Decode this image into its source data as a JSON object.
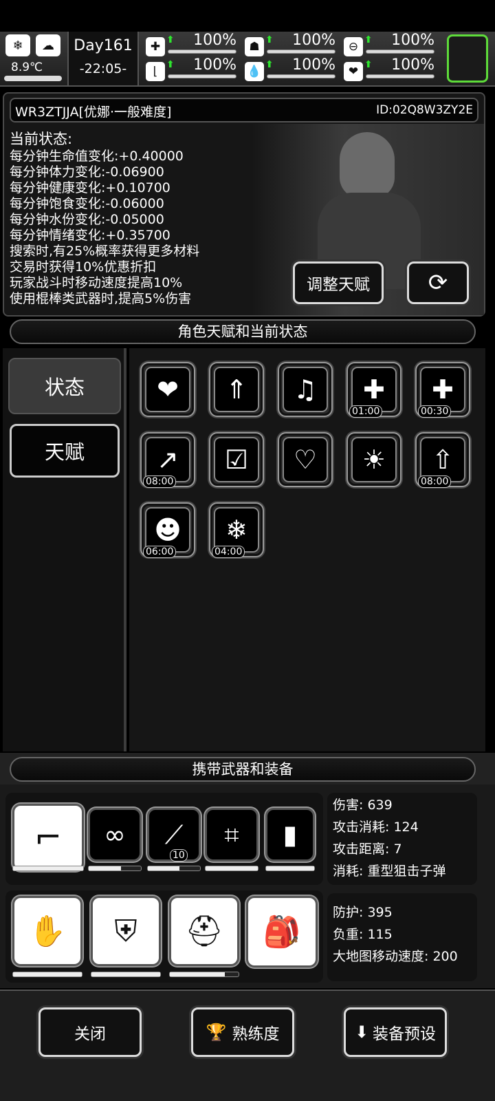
{
  "hud": {
    "season_icon": "snowflake-icon",
    "weather_icon": "cloud-icon",
    "temperature": "8.9℃",
    "day": "Day161",
    "time": "-22:05-",
    "stats": [
      {
        "icon": "medkit-icon",
        "value": "100%",
        "level": 1.0
      },
      {
        "icon": "stomach-icon",
        "value": "100%",
        "level": 1.0
      },
      {
        "icon": "lock-icon",
        "value": "100%",
        "level": 1.0
      },
      {
        "icon": "boot-icon",
        "value": "100%",
        "level": 1.0
      },
      {
        "icon": "water-drop-icon",
        "value": "100%",
        "level": 1.0
      },
      {
        "icon": "heart-icon",
        "value": "100%",
        "level": 1.0
      }
    ],
    "accent": "#2ee52e"
  },
  "character": {
    "name": "WR3ZTJJA[优娜·一般难度]",
    "id": "ID:02Q8W3ZY2E",
    "status_title": "当前状态:",
    "status_lines": [
      "每分钟生命值变化:+0.40000",
      "每分钟体力变化:-0.06900",
      "每分钟健康变化:+0.10700",
      "每分钟饱食变化:-0.06000",
      "每分钟水份变化:-0.05000",
      "每分钟情绪变化:+0.35700",
      "搜索时,有25%概率获得更多材料",
      "交易时获得10%优惠折扣",
      "玩家战斗时移动速度提高10%",
      "使用棍棒类武器时,提高5%伤害"
    ],
    "adjust_talent_label": "调整天赋"
  },
  "section1_title": "角色天赋和当前状态",
  "tabs": {
    "status": "状态",
    "talent": "天赋"
  },
  "buffs": [
    {
      "icon": "heart-icon",
      "glyph": "❤",
      "timer": ""
    },
    {
      "icon": "stomach-up-icon",
      "glyph": "⇑",
      "timer": ""
    },
    {
      "icon": "music-heart-icon",
      "glyph": "♫",
      "timer": ""
    },
    {
      "icon": "medkit-plus-icon",
      "glyph": "✚",
      "timer": "01:00"
    },
    {
      "icon": "pill-plus-icon",
      "glyph": "✚",
      "timer": "00:30"
    },
    {
      "icon": "syringe-icon",
      "glyph": "↗",
      "timer": "08:00"
    },
    {
      "icon": "clipboard-pill-icon",
      "glyph": "☑",
      "timer": ""
    },
    {
      "icon": "heart-stomach-icon",
      "glyph": "♡",
      "timer": ""
    },
    {
      "icon": "alarm-person-icon",
      "glyph": "☀",
      "timer": ""
    },
    {
      "icon": "bottle-up-icon",
      "glyph": "⇧",
      "timer": "08:00"
    },
    {
      "icon": "sleep-person-icon",
      "glyph": "☻",
      "timer": "06:00"
    },
    {
      "icon": "frozen-food-icon",
      "glyph": "❄",
      "timer": "04:00"
    }
  ],
  "section2_title": "携带武器和装备",
  "weapons": [
    {
      "icon": "sniper-rifle-icon",
      "glyph": "⌐",
      "badge": "",
      "durability": 1.0
    },
    {
      "icon": "chain-icon",
      "glyph": "∞",
      "badge": "",
      "durability": 0.62
    },
    {
      "icon": "rifle-icon",
      "glyph": "⟋",
      "badge": "10",
      "durability": 0.6
    },
    {
      "icon": "net-icon",
      "glyph": "⌗",
      "badge": "",
      "durability": 1.0
    },
    {
      "icon": "armor-plate-icon",
      "glyph": "▮",
      "badge": "",
      "durability": 1.0
    }
  ],
  "weapon_stats": [
    "伤害: 639",
    "攻击消耗: 124",
    "攻击距离: 7",
    "消耗: 重型狙击子弹"
  ],
  "armor": [
    {
      "icon": "gloves-icon",
      "glyph": "✋",
      "durability": 1.0
    },
    {
      "icon": "body-armor-icon",
      "glyph": "⛨",
      "durability": 1.0
    },
    {
      "icon": "helmet-icon",
      "glyph": "⛑",
      "durability": 0.8
    }
  ],
  "backpack_icon": "backpack-icon",
  "armor_stats": [
    "防护: 395",
    "负重: 115",
    "大地图移动速度: 200"
  ],
  "footer": {
    "close": "关闭",
    "proficiency": "熟练度",
    "preset": "装备预设"
  }
}
